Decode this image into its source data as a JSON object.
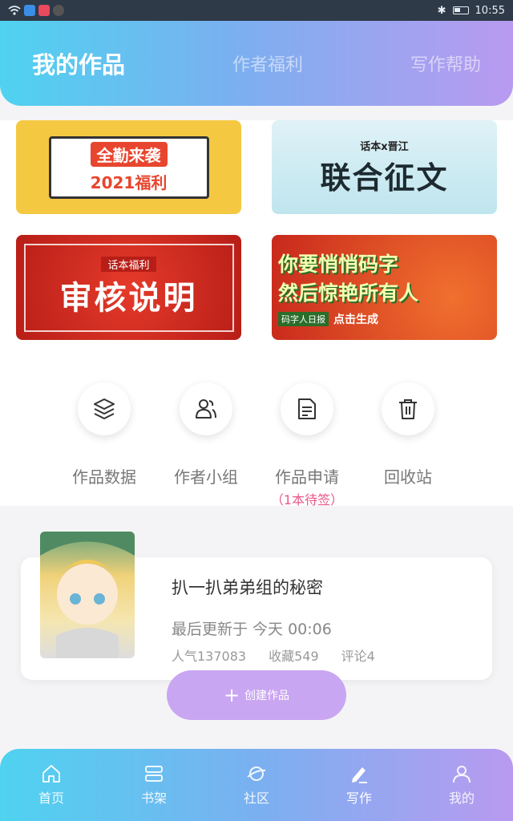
{
  "status_bar": {
    "time": "10:55"
  },
  "header": {
    "tabs": [
      {
        "label": "我的作品",
        "active": true
      },
      {
        "label": "作者福利",
        "active": false
      },
      {
        "label": "写作帮助",
        "active": false
      }
    ]
  },
  "banners": {
    "b1": {
      "line1": "全勤来袭",
      "line2": "2021福利"
    },
    "b2": {
      "small": "话本x晋江",
      "big": "联合征文"
    },
    "b3": {
      "small": "话本福利",
      "big": "审核说明"
    },
    "b4": {
      "line1": "你要悄悄码字",
      "line2": "然后惊艳所有人",
      "chip": "码字人日报",
      "cta": "点击生成"
    }
  },
  "shortcuts": [
    {
      "label": "作品数据",
      "icon": "layers-icon"
    },
    {
      "label": "作者小组",
      "icon": "group-icon"
    },
    {
      "label": "作品申请",
      "sub": "（1本待签）",
      "icon": "document-icon"
    },
    {
      "label": "回收站",
      "icon": "trash-icon"
    }
  ],
  "work": {
    "title": "扒一扒弟弟组的秘密",
    "update": "最后更新于 今天 00:06",
    "popularity": "人气137083",
    "favorites": "收藏549",
    "comments": "评论4"
  },
  "create_button": {
    "label": "创建作品"
  },
  "tabbar": [
    {
      "label": "首页",
      "icon": "home-icon"
    },
    {
      "label": "书架",
      "icon": "bookshelf-icon"
    },
    {
      "label": "社区",
      "icon": "planet-icon"
    },
    {
      "label": "写作",
      "icon": "pen-icon"
    },
    {
      "label": "我的",
      "icon": "user-icon"
    }
  ],
  "colors": {
    "gradient_start": "#4fd2f0",
    "gradient_end": "#b99af0",
    "pending_pink": "#e8598a",
    "create_button": "#c9a6f2"
  }
}
